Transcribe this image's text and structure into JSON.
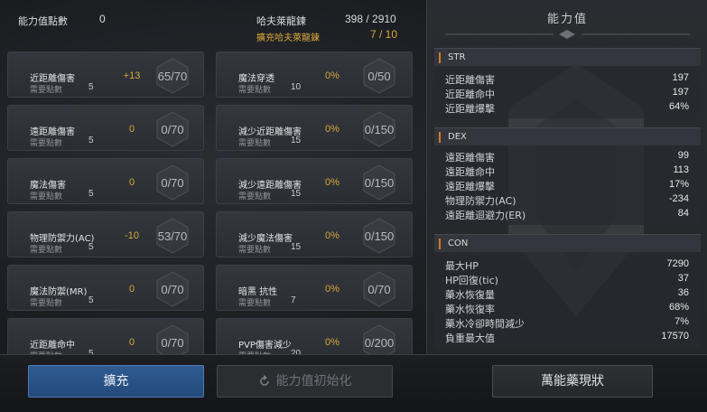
{
  "header": {
    "points_label": "能力值點數",
    "points_value": "0",
    "ha_label": "哈夫萊龍鍊",
    "ha_value": "398 / 2910",
    "ha_expand_label": "擴充哈夫萊龍鍊",
    "ha_expand_value": "7 / 10"
  },
  "left_cards": [
    {
      "name": "近距離傷害",
      "need_label": "需要點數",
      "need": "5",
      "bonus": "+13",
      "value": "65/70"
    },
    {
      "name": "遠距離傷害",
      "need_label": "需要點數",
      "need": "5",
      "bonus": "0",
      "value": "0/70"
    },
    {
      "name": "魔法傷害",
      "need_label": "需要點數",
      "need": "5",
      "bonus": "0",
      "value": "0/70"
    },
    {
      "name": "物理防禦力(AC)",
      "need_label": "需要點數",
      "need": "5",
      "bonus": "-10",
      "value": "53/70"
    },
    {
      "name": "魔法防禦(MR)",
      "need_label": "需要點數",
      "need": "5",
      "bonus": "0",
      "value": "0/70"
    },
    {
      "name": "近距離命中",
      "need_label": "需要點數",
      "need": "5",
      "bonus": "0",
      "value": "0/70"
    }
  ],
  "right_cards": [
    {
      "name": "魔法穿透",
      "need_label": "需要點數",
      "need": "10",
      "bonus": "0%",
      "value": "0/50"
    },
    {
      "name": "減少近距離傷害",
      "need_label": "需要點數",
      "need": "15",
      "bonus": "0%",
      "value": "0/150"
    },
    {
      "name": "減少遠距離傷害",
      "need_label": "需要點數",
      "need": "15",
      "bonus": "0%",
      "value": "0/150"
    },
    {
      "name": "減少魔法傷害",
      "need_label": "需要點數",
      "need": "15",
      "bonus": "0%",
      "value": "0/150"
    },
    {
      "name": "暗黑 抗性",
      "need_label": "需要點數",
      "need": "7",
      "bonus": "0%",
      "value": "0/70"
    },
    {
      "name": "PVP傷害減少",
      "need_label": "需要點數",
      "need": "20",
      "bonus": "0%",
      "value": "0/200"
    }
  ],
  "panel": {
    "title": "能力值",
    "sections": [
      {
        "name": "STR",
        "rows": [
          {
            "label": "近距離傷害",
            "value": "197"
          },
          {
            "label": "近距離命中",
            "value": "197"
          },
          {
            "label": "近距離爆擊",
            "value": "64%"
          }
        ]
      },
      {
        "name": "DEX",
        "rows": [
          {
            "label": "遠距離傷害",
            "value": "99"
          },
          {
            "label": "遠距離命中",
            "value": "113"
          },
          {
            "label": "遠距離爆擊",
            "value": "17%"
          },
          {
            "label": "物理防禦力(AC)",
            "value": "-234"
          },
          {
            "label": "遠距離迴避力(ER)",
            "value": "84"
          }
        ]
      },
      {
        "name": "CON",
        "rows": [
          {
            "label": "最大HP",
            "value": "7290"
          },
          {
            "label": "HP回復(tic)",
            "value": "37"
          },
          {
            "label": "藥水恢復量",
            "value": "36"
          },
          {
            "label": "藥水恢復率",
            "value": "68%"
          },
          {
            "label": "藥水冷卻時間減少",
            "value": "7%"
          },
          {
            "label": "負重最大值",
            "value": "17570"
          }
        ]
      }
    ]
  },
  "buttons": {
    "expand": "擴充",
    "reset": "能力值初始化",
    "potion": "萬能藥現狀"
  },
  "colors": {
    "gold": "#d8a83a",
    "accent_blue": "#2f5b92",
    "section_bar": "#d07a2a"
  }
}
